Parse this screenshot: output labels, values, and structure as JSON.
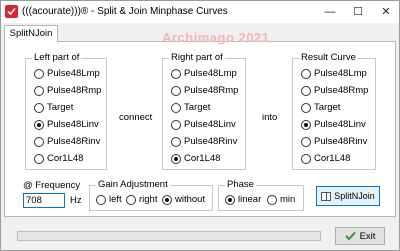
{
  "window": {
    "title": "(((acourate)))® - Split & Join Minphase Curves",
    "watermark": "Archimago 2021",
    "controls": {
      "minimize": "—",
      "maximize": "☐",
      "close": "✕"
    }
  },
  "tab": {
    "label": "SplitNJoin"
  },
  "left_group": {
    "title": "Left part of",
    "options": [
      "Pulse48Lmp",
      "Pulse48Rmp",
      "Target",
      "Pulse48Linv",
      "Pulse48Rinv",
      "Cor1L48"
    ],
    "selected": "Pulse48Linv"
  },
  "connect_label": "connect",
  "right_group": {
    "title": "Right part of",
    "options": [
      "Pulse48Lmp",
      "Pulse48Rmp",
      "Target",
      "Pulse48Linv",
      "Pulse48Rinv",
      "Cor1L48"
    ],
    "selected": "Cor1L48"
  },
  "into_label": "into",
  "result_group": {
    "title": "Result Curve",
    "options": [
      "Pulse48Lmp",
      "Pulse48Rmp",
      "Target",
      "Pulse48Linv",
      "Pulse48Rinv",
      "Cor1L48"
    ],
    "selected": "Pulse48Linv"
  },
  "frequency": {
    "label": "@ Frequency",
    "value": "708",
    "unit": "Hz"
  },
  "gain_group": {
    "title": "Gain Adjustment",
    "options": [
      "left",
      "right",
      "without"
    ],
    "selected": "without"
  },
  "phase_group": {
    "title": "Phase",
    "options": [
      "linear",
      "min"
    ],
    "selected": "linear"
  },
  "splitnjoin_button": "SplitNJoin",
  "progress": {
    "fraction": 0
  },
  "exit_button": "Exit",
  "colors": {
    "accent": "#0078d7",
    "progress": "#06b025",
    "watermark": "#f2b6b6"
  }
}
